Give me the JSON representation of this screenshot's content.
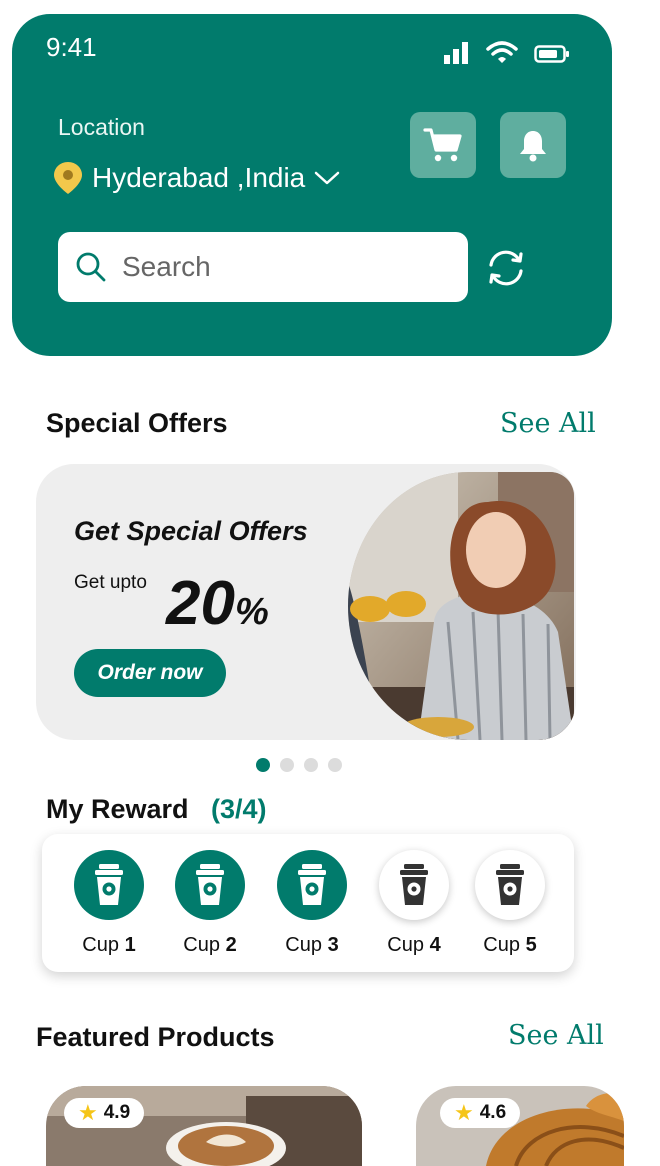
{
  "status_bar": {
    "time": "9:41"
  },
  "header": {
    "location_label": "Location",
    "location_value": "Hyderabad ,India",
    "search_placeholder": "Search"
  },
  "special_offers": {
    "title": "Special Offers",
    "see_all": "See All",
    "banner": {
      "headline": "Get Special Offers",
      "upto": "Get upto",
      "percent_value": "20",
      "percent_sign": "%",
      "cta": "Order now"
    },
    "pagination": {
      "total": 4,
      "active": 1
    }
  },
  "rewards": {
    "title": "My Reward",
    "count": "(3/4)",
    "cups": [
      {
        "prefix": "Cup",
        "num": "1",
        "done": true
      },
      {
        "prefix": "Cup",
        "num": "2",
        "done": true
      },
      {
        "prefix": "Cup",
        "num": "3",
        "done": true
      },
      {
        "prefix": "Cup",
        "num": "4",
        "done": false
      },
      {
        "prefix": "Cup",
        "num": "5",
        "done": false
      }
    ]
  },
  "featured": {
    "title": "Featured Products",
    "see_all": "See All",
    "products": [
      {
        "rating": "4.9",
        "image": "latte-art-coffee"
      },
      {
        "rating": "4.6",
        "image": "croissants"
      }
    ]
  },
  "colors": {
    "brand": "#017b6c",
    "button_tint": "#5fae9f",
    "card_bg": "#eeeeee",
    "star": "#f5c518",
    "pin": "#f2c84b"
  }
}
